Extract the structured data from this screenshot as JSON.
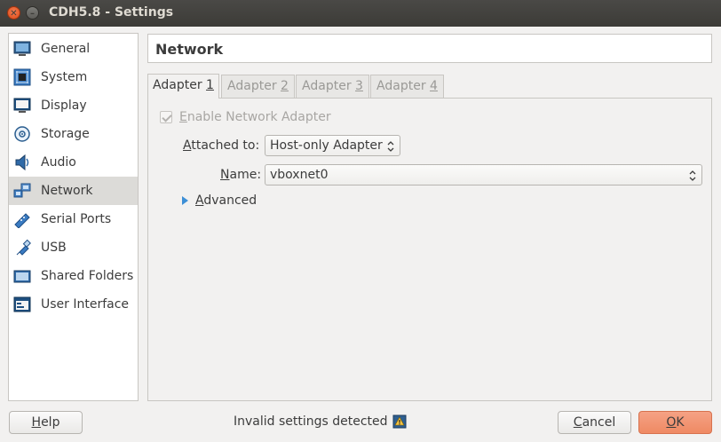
{
  "window": {
    "title": "CDH5.8 - Settings"
  },
  "sidebar": {
    "items": [
      {
        "label": "General",
        "icon": "monitor-icon"
      },
      {
        "label": "System",
        "icon": "chip-icon"
      },
      {
        "label": "Display",
        "icon": "display-icon"
      },
      {
        "label": "Storage",
        "icon": "disk-icon"
      },
      {
        "label": "Audio",
        "icon": "speaker-icon"
      },
      {
        "label": "Network",
        "icon": "network-icon",
        "active": true
      },
      {
        "label": "Serial Ports",
        "icon": "serial-port-icon"
      },
      {
        "label": "USB",
        "icon": "usb-icon"
      },
      {
        "label": "Shared Folders",
        "icon": "folder-icon"
      },
      {
        "label": "User Interface",
        "icon": "window-icon"
      }
    ]
  },
  "page": {
    "title": "Network"
  },
  "tabs": [
    {
      "label_prefix": "Adapter ",
      "label_key": "1",
      "active": true
    },
    {
      "label_prefix": "Adapter ",
      "label_key": "2"
    },
    {
      "label_prefix": "Adapter ",
      "label_key": "3"
    },
    {
      "label_prefix": "Adapter ",
      "label_key": "4"
    }
  ],
  "adapter": {
    "enable_label_key": "E",
    "enable_label_rest": "nable Network Adapter",
    "enabled": true,
    "attached_label_key": "A",
    "attached_label_rest": "ttached to:",
    "attached_value": "Host-only Adapter",
    "name_label_key": "N",
    "name_label_rest": "ame:",
    "name_value": "vboxnet0",
    "advanced_label_key": "A",
    "advanced_label_rest": "dvanced"
  },
  "footer": {
    "help_key": "H",
    "help_rest": "elp",
    "status": "Invalid settings detected",
    "cancel_key": "C",
    "cancel_rest": "ancel",
    "ok_key": "O",
    "ok_rest": "K"
  },
  "colors": {
    "accent": "#ef8a63",
    "selection": "#dcdbd8"
  }
}
